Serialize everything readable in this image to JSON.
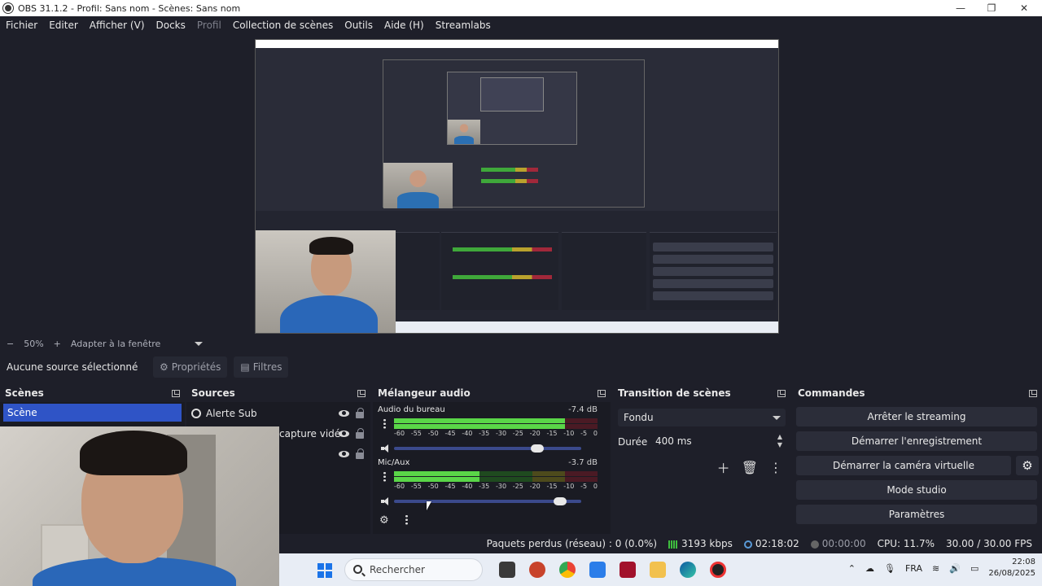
{
  "window": {
    "title": "OBS 31.1.2 - Profil: Sans nom - Scènes: Sans nom"
  },
  "menu": [
    {
      "label": "Fichier",
      "disabled": false
    },
    {
      "label": "Editer",
      "disabled": false
    },
    {
      "label": "Afficher (V)",
      "disabled": false
    },
    {
      "label": "Docks",
      "disabled": false
    },
    {
      "label": "Profil",
      "disabled": true
    },
    {
      "label": "Collection de scènes",
      "disabled": false
    },
    {
      "label": "Outils",
      "disabled": false
    },
    {
      "label": "Aide (H)",
      "disabled": false
    },
    {
      "label": "Streamlabs",
      "disabled": false
    }
  ],
  "zoom": {
    "minus": "−",
    "level": "50%",
    "plus": "+",
    "fit": "Adapter à la fenêtre"
  },
  "properties_bar": {
    "no_selection": "Aucune source sélectionné",
    "properties": "Propriétés",
    "filters": "Filtres"
  },
  "scenes": {
    "title": "Scènes",
    "items": [
      "Scène"
    ]
  },
  "sources": {
    "title": "Sources",
    "items": [
      "Alerte Sub",
      "capture vidé",
      ""
    ]
  },
  "mixer": {
    "title": "Mélangeur audio",
    "channels": [
      {
        "name": "Audio du bureau",
        "db": "-7.4 dB",
        "level": 0.84,
        "volume": 0.8
      },
      {
        "name": "Mic/Aux",
        "db": "-3.7 dB",
        "level": 0.42,
        "volume": 0.92
      }
    ],
    "ticks": [
      "-60",
      "-55",
      "-50",
      "-45",
      "-40",
      "-35",
      "-30",
      "-25",
      "-20",
      "-15",
      "-10",
      "-5",
      "0"
    ]
  },
  "transition": {
    "title": "Transition de scènes",
    "type": "Fondu",
    "duration_label": "Durée",
    "duration": "400 ms"
  },
  "controls": {
    "title": "Commandes",
    "buttons": [
      "Arrêter le streaming",
      "Démarrer l'enregistrement",
      "Démarrer la caméra virtuelle",
      "Mode studio",
      "Paramètres"
    ]
  },
  "status": {
    "dropped": "Paquets perdus (réseau) : 0 (0.0%)",
    "bitrate": "3193 kbps",
    "stream_time": "02:18:02",
    "rec_time": "00:00:00",
    "cpu": "CPU: 11.7%",
    "fps": "30.00 / 30.00 FPS"
  },
  "taskbar": {
    "search_placeholder": "Rechercher",
    "lang": "FRA",
    "time": "22:08",
    "date": "26/08/2025"
  },
  "colors": {
    "accent": "#2f54c6",
    "background": "#1e1f29",
    "meter_green": "#5ad648"
  }
}
